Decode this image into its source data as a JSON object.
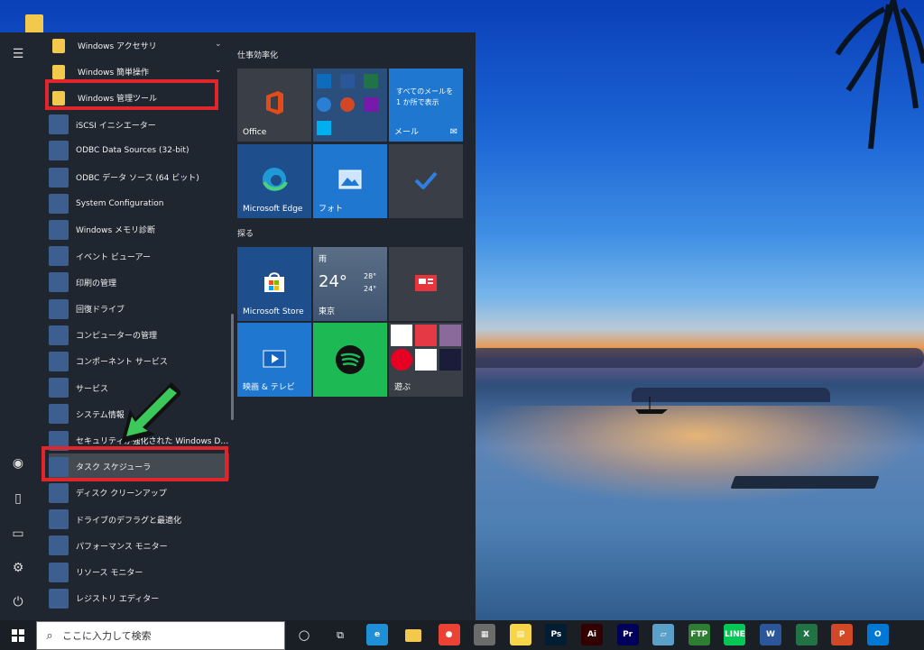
{
  "start_menu": {
    "app_list": [
      {
        "label": "Windows アクセサリ",
        "type": "folder",
        "chevron": "⌄"
      },
      {
        "label": "Windows 簡単操作",
        "type": "folder",
        "chevron": "⌄"
      },
      {
        "label": "Windows 管理ツール",
        "type": "folder",
        "chevron": ""
      },
      {
        "label": "iSCSI イニシエーター",
        "type": "app",
        "chevron": ""
      },
      {
        "label": "ODBC Data Sources (32-bit)",
        "type": "app",
        "chevron": ""
      },
      {
        "label": "ODBC データ ソース (64 ビット)",
        "type": "app",
        "chevron": ""
      },
      {
        "label": "System Configuration",
        "type": "app",
        "chevron": ""
      },
      {
        "label": "Windows メモリ診断",
        "type": "app",
        "chevron": ""
      },
      {
        "label": "イベント ビューアー",
        "type": "app",
        "chevron": ""
      },
      {
        "label": "印刷の管理",
        "type": "app",
        "chevron": ""
      },
      {
        "label": "回復ドライブ",
        "type": "app",
        "chevron": ""
      },
      {
        "label": "コンピューターの管理",
        "type": "app",
        "chevron": ""
      },
      {
        "label": "コンポーネント サービス",
        "type": "app",
        "chevron": ""
      },
      {
        "label": "サービス",
        "type": "app",
        "chevron": ""
      },
      {
        "label": "システム情報",
        "type": "app",
        "chevron": ""
      },
      {
        "label": "セキュリティが強化された Windows De...",
        "type": "app",
        "chevron": ""
      },
      {
        "label": "タスク スケジューラ",
        "type": "app",
        "chevron": ""
      },
      {
        "label": "ディスク クリーンアップ",
        "type": "app",
        "chevron": ""
      },
      {
        "label": "ドライブのデフラグと最適化",
        "type": "app",
        "chevron": ""
      },
      {
        "label": "パフォーマンス モニター",
        "type": "app",
        "chevron": ""
      },
      {
        "label": "リソース モニター",
        "type": "app",
        "chevron": ""
      },
      {
        "label": "レジストリ エディター",
        "type": "app",
        "chevron": ""
      }
    ],
    "groups": {
      "productivity": "仕事効率化",
      "explore": "探る"
    },
    "tiles": {
      "office": "Office",
      "mail_text": "すべてのメールを 1 か所で表示",
      "mail": "メール",
      "edge": "Microsoft Edge",
      "photos": "フォト",
      "store": "Microsoft Store",
      "weather_cond": "雨",
      "weather_temp": "24°",
      "weather_high": "28°",
      "weather_low": "24°",
      "weather_city": "東京",
      "movies": "映画 & テレビ",
      "play": "遊ぶ"
    }
  },
  "taskbar": {
    "search_placeholder": "ここに入力して検索",
    "apps": [
      {
        "name": "edge",
        "glyph": "e",
        "color": "#1f8fd6"
      },
      {
        "name": "chrome",
        "glyph": "●",
        "color": "#ea4335"
      },
      {
        "name": "calculator",
        "glyph": "▦",
        "color": "#6b6b6b"
      },
      {
        "name": "sticky-notes",
        "glyph": "▤",
        "color": "#f7d54a"
      },
      {
        "name": "photoshop",
        "glyph": "Ps",
        "color": "#001d34"
      },
      {
        "name": "illustrator",
        "glyph": "Ai",
        "color": "#330000"
      },
      {
        "name": "premiere",
        "glyph": "Pr",
        "color": "#00005b"
      },
      {
        "name": "notepad",
        "glyph": "▱",
        "color": "#5aa0c8"
      },
      {
        "name": "ffftp",
        "glyph": "FTP",
        "color": "#2e7d32"
      },
      {
        "name": "line",
        "glyph": "LINE",
        "color": "#06c755"
      },
      {
        "name": "word",
        "glyph": "W",
        "color": "#2b579a"
      },
      {
        "name": "excel",
        "glyph": "X",
        "color": "#217346"
      },
      {
        "name": "powerpoint",
        "glyph": "P",
        "color": "#d24726"
      },
      {
        "name": "outlook",
        "glyph": "O",
        "color": "#0078d4"
      }
    ]
  }
}
